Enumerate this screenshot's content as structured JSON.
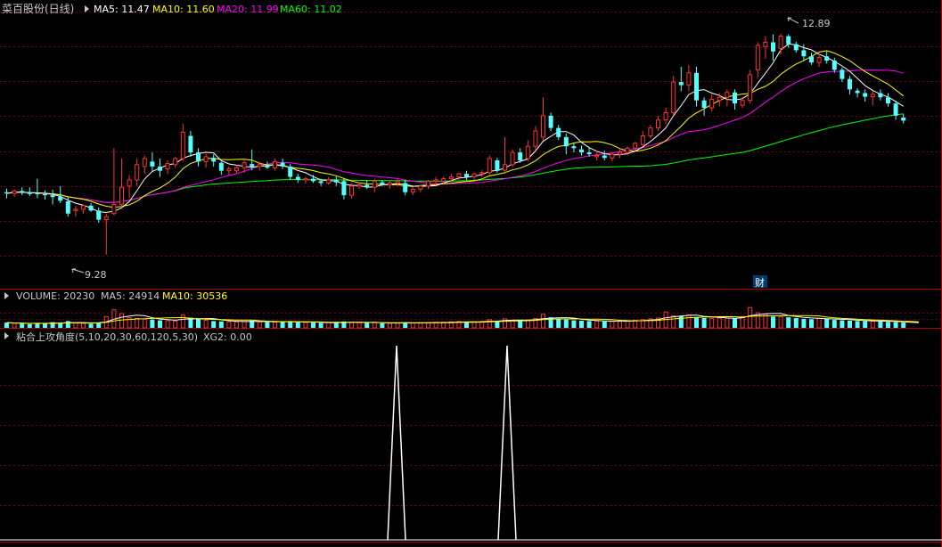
{
  "main_panel": {
    "stock_name": "菜百股份(日线)",
    "ma5_label": "MA5: 11.47",
    "ma10_label": "MA10: 11.60",
    "ma20_label": "MA20: 11.99",
    "ma60_label": "MA60: 11.02",
    "high_label": "12.89",
    "low_label": "9.28",
    "event_badge": "财"
  },
  "volume_panel": {
    "volume_label": "VOLUME: 20230",
    "ma5_label": "MA5: 24914",
    "ma10_label": "MA10: 30536"
  },
  "indicator_panel": {
    "title": "粘合上攻角度(5,10,20,30,60,120,5,30)",
    "xg2_label": "XG2: 0.00"
  },
  "colors": {
    "background": "#000000",
    "up": "#ff3232",
    "down": "#54ffff",
    "ma5": "#ffffff",
    "ma10": "#ffff00",
    "ma20": "#ff00ff",
    "ma60": "#00ff00",
    "separator": "#b00000",
    "grid": "#7a0000",
    "text": "#c8c8c8"
  },
  "chart_data": {
    "type": "candlestick",
    "price_range": [
      9.0,
      13.15
    ],
    "indicator_range": [
      0,
      1
    ],
    "candles": [
      {
        "o": 10.3,
        "h": 10.36,
        "l": 10.2,
        "c": 10.28
      },
      {
        "o": 10.28,
        "h": 10.35,
        "l": 10.22,
        "c": 10.32
      },
      {
        "o": 10.32,
        "h": 10.38,
        "l": 10.25,
        "c": 10.3
      },
      {
        "o": 10.3,
        "h": 10.38,
        "l": 10.24,
        "c": 10.27
      },
      {
        "o": 10.28,
        "h": 10.52,
        "l": 10.2,
        "c": 10.27
      },
      {
        "o": 10.27,
        "h": 10.33,
        "l": 10.18,
        "c": 10.25
      },
      {
        "o": 10.25,
        "h": 10.34,
        "l": 10.1,
        "c": 10.22
      },
      {
        "o": 10.23,
        "h": 10.4,
        "l": 10.12,
        "c": 10.16
      },
      {
        "o": 10.15,
        "h": 10.22,
        "l": 9.9,
        "c": 9.95
      },
      {
        "o": 10.0,
        "h": 10.08,
        "l": 9.9,
        "c": 10.02
      },
      {
        "o": 10.02,
        "h": 10.1,
        "l": 9.95,
        "c": 10.08
      },
      {
        "o": 10.08,
        "h": 10.12,
        "l": 9.98,
        "c": 10.0
      },
      {
        "o": 10.0,
        "h": 10.05,
        "l": 9.8,
        "c": 9.85
      },
      {
        "o": 9.85,
        "h": 9.95,
        "l": 9.28,
        "c": 9.9
      },
      {
        "o": 9.95,
        "h": 11.02,
        "l": 9.92,
        "c": 10.1
      },
      {
        "o": 10.1,
        "h": 10.85,
        "l": 10.05,
        "c": 10.38
      },
      {
        "o": 10.4,
        "h": 10.58,
        "l": 10.2,
        "c": 10.5
      },
      {
        "o": 10.5,
        "h": 10.85,
        "l": 10.4,
        "c": 10.75
      },
      {
        "o": 10.72,
        "h": 10.9,
        "l": 10.6,
        "c": 10.85
      },
      {
        "o": 10.8,
        "h": 10.95,
        "l": 10.65,
        "c": 10.72
      },
      {
        "o": 10.72,
        "h": 10.85,
        "l": 10.55,
        "c": 10.65
      },
      {
        "o": 10.68,
        "h": 10.82,
        "l": 10.6,
        "c": 10.77
      },
      {
        "o": 10.75,
        "h": 10.88,
        "l": 10.7,
        "c": 10.85
      },
      {
        "o": 10.85,
        "h": 11.42,
        "l": 10.8,
        "c": 11.28
      },
      {
        "o": 11.22,
        "h": 11.3,
        "l": 10.88,
        "c": 10.95
      },
      {
        "o": 10.95,
        "h": 11.02,
        "l": 10.72,
        "c": 10.8
      },
      {
        "o": 10.8,
        "h": 10.93,
        "l": 10.7,
        "c": 10.88
      },
      {
        "o": 10.86,
        "h": 10.92,
        "l": 10.72,
        "c": 10.8
      },
      {
        "o": 10.78,
        "h": 10.8,
        "l": 10.58,
        "c": 10.65
      },
      {
        "o": 10.65,
        "h": 10.72,
        "l": 10.58,
        "c": 10.68
      },
      {
        "o": 10.65,
        "h": 10.75,
        "l": 10.6,
        "c": 10.7
      },
      {
        "o": 10.7,
        "h": 10.82,
        "l": 10.62,
        "c": 10.78
      },
      {
        "o": 10.76,
        "h": 11.0,
        "l": 10.66,
        "c": 10.72
      },
      {
        "o": 10.72,
        "h": 10.8,
        "l": 10.65,
        "c": 10.75
      },
      {
        "o": 10.74,
        "h": 10.8,
        "l": 10.68,
        "c": 10.7
      },
      {
        "o": 10.7,
        "h": 10.85,
        "l": 10.65,
        "c": 10.8
      },
      {
        "o": 10.78,
        "h": 10.85,
        "l": 10.68,
        "c": 10.72
      },
      {
        "o": 10.72,
        "h": 10.76,
        "l": 10.5,
        "c": 10.55
      },
      {
        "o": 10.55,
        "h": 10.6,
        "l": 10.45,
        "c": 10.5
      },
      {
        "o": 10.5,
        "h": 10.55,
        "l": 10.44,
        "c": 10.52
      },
      {
        "o": 10.52,
        "h": 10.58,
        "l": 10.45,
        "c": 10.48
      },
      {
        "o": 10.48,
        "h": 10.52,
        "l": 10.4,
        "c": 10.45
      },
      {
        "o": 10.45,
        "h": 10.55,
        "l": 10.42,
        "c": 10.5
      },
      {
        "o": 10.5,
        "h": 10.56,
        "l": 10.4,
        "c": 10.46
      },
      {
        "o": 10.48,
        "h": 10.52,
        "l": 10.18,
        "c": 10.25
      },
      {
        "o": 10.25,
        "h": 10.45,
        "l": 10.2,
        "c": 10.4
      },
      {
        "o": 10.4,
        "h": 10.46,
        "l": 10.35,
        "c": 10.42
      },
      {
        "o": 10.42,
        "h": 10.5,
        "l": 10.35,
        "c": 10.38
      },
      {
        "o": 10.38,
        "h": 10.52,
        "l": 10.3,
        "c": 10.48
      },
      {
        "o": 10.46,
        "h": 10.5,
        "l": 10.4,
        "c": 10.42
      },
      {
        "o": 10.42,
        "h": 10.48,
        "l": 10.36,
        "c": 10.45
      },
      {
        "o": 10.45,
        "h": 10.52,
        "l": 10.4,
        "c": 10.48
      },
      {
        "o": 10.45,
        "h": 10.5,
        "l": 10.25,
        "c": 10.3
      },
      {
        "o": 10.3,
        "h": 10.38,
        "l": 10.25,
        "c": 10.35
      },
      {
        "o": 10.35,
        "h": 10.42,
        "l": 10.3,
        "c": 10.4
      },
      {
        "o": 10.4,
        "h": 10.5,
        "l": 10.35,
        "c": 10.48
      },
      {
        "o": 10.48,
        "h": 10.55,
        "l": 10.42,
        "c": 10.5
      },
      {
        "o": 10.48,
        "h": 10.55,
        "l": 10.42,
        "c": 10.52
      },
      {
        "o": 10.52,
        "h": 10.6,
        "l": 10.46,
        "c": 10.55
      },
      {
        "o": 10.55,
        "h": 10.62,
        "l": 10.5,
        "c": 10.6
      },
      {
        "o": 10.6,
        "h": 10.65,
        "l": 10.5,
        "c": 10.55
      },
      {
        "o": 10.55,
        "h": 10.62,
        "l": 10.5,
        "c": 10.6
      },
      {
        "o": 10.6,
        "h": 10.66,
        "l": 10.55,
        "c": 10.62
      },
      {
        "o": 10.62,
        "h": 10.9,
        "l": 10.58,
        "c": 10.85
      },
      {
        "o": 10.82,
        "h": 10.86,
        "l": 10.62,
        "c": 10.65
      },
      {
        "o": 10.66,
        "h": 11.2,
        "l": 10.6,
        "c": 10.75
      },
      {
        "o": 10.75,
        "h": 11.0,
        "l": 10.72,
        "c": 10.95
      },
      {
        "o": 10.95,
        "h": 11.02,
        "l": 10.78,
        "c": 10.82
      },
      {
        "o": 10.85,
        "h": 11.15,
        "l": 10.8,
        "c": 11.05
      },
      {
        "o": 11.05,
        "h": 11.38,
        "l": 10.98,
        "c": 11.3
      },
      {
        "o": 11.2,
        "h": 11.85,
        "l": 11.15,
        "c": 11.55
      },
      {
        "o": 11.55,
        "h": 11.6,
        "l": 11.3,
        "c": 11.35
      },
      {
        "o": 11.35,
        "h": 11.4,
        "l": 11.15,
        "c": 11.2
      },
      {
        "o": 11.2,
        "h": 11.26,
        "l": 10.92,
        "c": 11.05
      },
      {
        "o": 11.05,
        "h": 11.1,
        "l": 10.95,
        "c": 11.02
      },
      {
        "o": 11.0,
        "h": 11.06,
        "l": 10.9,
        "c": 10.95
      },
      {
        "o": 10.95,
        "h": 11.04,
        "l": 10.88,
        "c": 10.92
      },
      {
        "o": 10.88,
        "h": 10.98,
        "l": 10.82,
        "c": 10.9
      },
      {
        "o": 10.9,
        "h": 10.98,
        "l": 10.82,
        "c": 10.86
      },
      {
        "o": 10.86,
        "h": 10.95,
        "l": 10.8,
        "c": 10.92
      },
      {
        "o": 10.92,
        "h": 11.0,
        "l": 10.86,
        "c": 10.95
      },
      {
        "o": 10.95,
        "h": 11.05,
        "l": 10.9,
        "c": 11.02
      },
      {
        "o": 11.02,
        "h": 11.12,
        "l": 10.98,
        "c": 11.1
      },
      {
        "o": 11.08,
        "h": 11.3,
        "l": 11.05,
        "c": 11.22
      },
      {
        "o": 11.22,
        "h": 11.4,
        "l": 11.18,
        "c": 11.35
      },
      {
        "o": 11.35,
        "h": 11.55,
        "l": 11.3,
        "c": 11.48
      },
      {
        "o": 11.48,
        "h": 11.68,
        "l": 11.42,
        "c": 11.6
      },
      {
        "o": 11.6,
        "h": 12.2,
        "l": 11.55,
        "c": 12.1
      },
      {
        "o": 12.1,
        "h": 12.35,
        "l": 11.95,
        "c": 12.05
      },
      {
        "o": 12.05,
        "h": 12.38,
        "l": 11.95,
        "c": 12.25
      },
      {
        "o": 12.25,
        "h": 12.35,
        "l": 11.7,
        "c": 11.8
      },
      {
        "o": 11.8,
        "h": 11.85,
        "l": 11.55,
        "c": 11.68
      },
      {
        "o": 11.68,
        "h": 11.9,
        "l": 11.62,
        "c": 11.82
      },
      {
        "o": 11.8,
        "h": 11.92,
        "l": 11.7,
        "c": 11.85
      },
      {
        "o": 11.85,
        "h": 11.98,
        "l": 11.7,
        "c": 11.93
      },
      {
        "o": 11.93,
        "h": 11.98,
        "l": 11.65,
        "c": 11.75
      },
      {
        "o": 11.72,
        "h": 11.86,
        "l": 11.68,
        "c": 11.8
      },
      {
        "o": 11.8,
        "h": 12.3,
        "l": 11.75,
        "c": 12.22
      },
      {
        "o": 12.3,
        "h": 12.75,
        "l": 12.18,
        "c": 12.7
      },
      {
        "o": 12.68,
        "h": 12.85,
        "l": 12.48,
        "c": 12.75
      },
      {
        "o": 12.75,
        "h": 12.88,
        "l": 12.45,
        "c": 12.6
      },
      {
        "o": 12.65,
        "h": 12.89,
        "l": 12.55,
        "c": 12.85
      },
      {
        "o": 12.85,
        "h": 12.88,
        "l": 12.66,
        "c": 12.72
      },
      {
        "o": 12.72,
        "h": 12.76,
        "l": 12.58,
        "c": 12.62
      },
      {
        "o": 12.62,
        "h": 12.72,
        "l": 12.45,
        "c": 12.52
      },
      {
        "o": 12.52,
        "h": 12.58,
        "l": 12.38,
        "c": 12.42
      },
      {
        "o": 12.42,
        "h": 12.56,
        "l": 12.35,
        "c": 12.5
      },
      {
        "o": 12.52,
        "h": 12.6,
        "l": 12.4,
        "c": 12.45
      },
      {
        "o": 12.45,
        "h": 12.5,
        "l": 12.25,
        "c": 12.3
      },
      {
        "o": 12.3,
        "h": 12.34,
        "l": 12.1,
        "c": 12.15
      },
      {
        "o": 12.15,
        "h": 12.2,
        "l": 11.9,
        "c": 11.98
      },
      {
        "o": 11.96,
        "h": 12.0,
        "l": 11.85,
        "c": 11.92
      },
      {
        "o": 11.92,
        "h": 11.98,
        "l": 11.78,
        "c": 11.86
      },
      {
        "o": 11.86,
        "h": 11.95,
        "l": 11.72,
        "c": 11.9
      },
      {
        "o": 11.92,
        "h": 11.98,
        "l": 11.8,
        "c": 11.85
      },
      {
        "o": 11.85,
        "h": 11.92,
        "l": 11.7,
        "c": 11.75
      },
      {
        "o": 11.75,
        "h": 11.8,
        "l": 11.48,
        "c": 11.55
      },
      {
        "o": 11.52,
        "h": 11.58,
        "l": 11.42,
        "c": 11.47
      }
    ],
    "volume": [
      14,
      12,
      11,
      10,
      13,
      12,
      15,
      12,
      18,
      13,
      12,
      11,
      14,
      30,
      48,
      38,
      27,
      25,
      23,
      22,
      20,
      19,
      18,
      34,
      27,
      24,
      20,
      18,
      17,
      16,
      16,
      17,
      19,
      16,
      15,
      15,
      16,
      18,
      15,
      14,
      14,
      13,
      14,
      13,
      17,
      15,
      14,
      13,
      14,
      12,
      12,
      13,
      15,
      13,
      13,
      14,
      15,
      15,
      16,
      17,
      16,
      16,
      17,
      22,
      18,
      24,
      20,
      19,
      21,
      25,
      36,
      28,
      24,
      22,
      20,
      19,
      18,
      18,
      17,
      17,
      18,
      19,
      20,
      22,
      24,
      26,
      42,
      32,
      32,
      34,
      28,
      26,
      25,
      26,
      26,
      25,
      30,
      54,
      40,
      36,
      30,
      30,
      28,
      26,
      24,
      23,
      25,
      24,
      21,
      20,
      19,
      18,
      18,
      18,
      17,
      16,
      15,
      14,
      13,
      12
    ],
    "signals_x": [
      445,
      569
    ]
  }
}
